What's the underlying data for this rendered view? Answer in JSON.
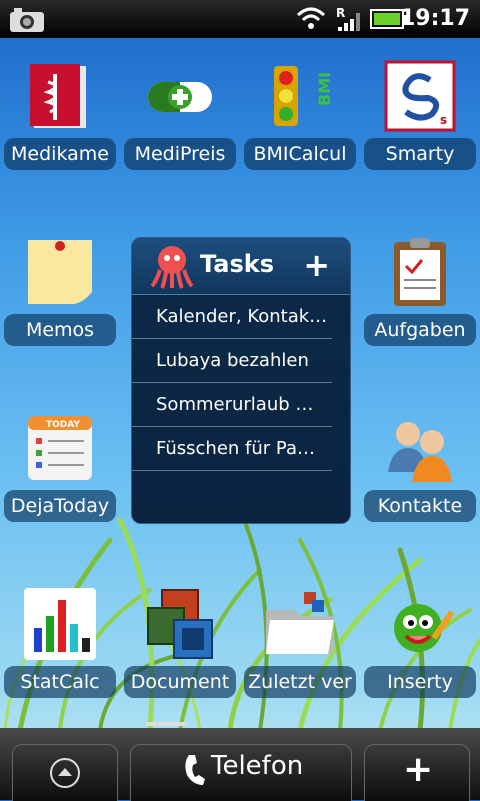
{
  "status_bar": {
    "time": "19:17",
    "icons": [
      "camera-notification-icon",
      "wifi-icon",
      "roaming-signal-icon",
      "battery-icon"
    ]
  },
  "apps": {
    "medikamente": "Medikame",
    "medipreis": "MediPreis",
    "bmi": "BMICalcul",
    "smarty": "Smarty",
    "memos": "Memos",
    "aufgaben": "Aufgaben",
    "dejatoday": "DejaToday",
    "kontakte": "Kontakte",
    "statcalc": "StatCalc",
    "documents": "Document",
    "zuletzt": "Zuletzt ver",
    "inserty": "Inserty"
  },
  "widget": {
    "title": "Tasks",
    "add_symbol": "+",
    "items": [
      "Kalender, Kontak…",
      "Lubaya bezahlen",
      "Sommerurlaub …",
      "Füsschen für Pa…"
    ]
  },
  "dock": {
    "phone_label": "Telefon",
    "add_symbol": "+"
  },
  "colors": {
    "status_bg": "#000000",
    "wallpaper_top": "#1a66c8",
    "wallpaper_bottom": "#c8ecf0",
    "widget_bg": "#0a2440"
  }
}
